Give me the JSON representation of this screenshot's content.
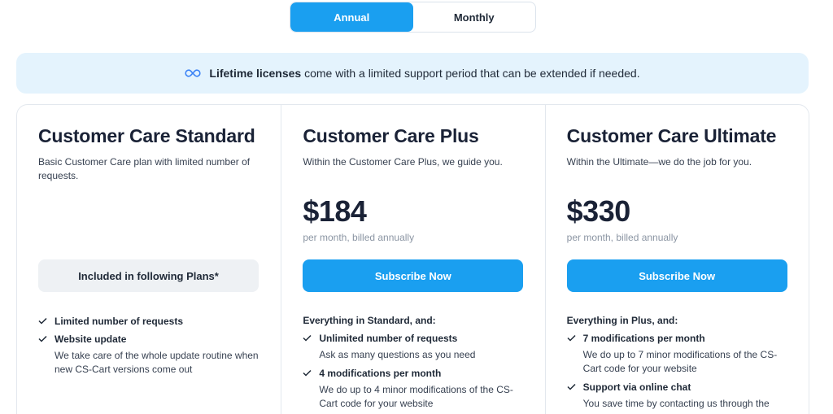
{
  "billing_toggle": {
    "annual": "Annual",
    "monthly": "Monthly"
  },
  "notice": {
    "bold": "Lifetime licenses",
    "rest": "come with a limited support period that can be extended if needed.",
    "icon": "infinity-icon"
  },
  "plans": [
    {
      "title": "Customer Care Standard",
      "desc": "Basic Customer Care plan with limited number of requests.",
      "cta": "Included in following Plans*",
      "features": [
        {
          "title": "Limited number of requests",
          "sub": ""
        },
        {
          "title": "Website update",
          "sub": "We take care of the whole update routine when new CS-Cart versions come out"
        }
      ]
    },
    {
      "title": "Customer Care Plus",
      "desc": "Within the Customer Care Plus, we guide you.",
      "price": "$184",
      "price_note": "per month, billed annually",
      "cta": "Subscribe Now",
      "features_head": "Everything in Standard, and:",
      "features": [
        {
          "title": "Unlimited number of requests",
          "sub": "Ask as many questions as you need"
        },
        {
          "title": "4 modifications per month",
          "sub": "We do up to 4 minor modifications of the CS-Cart code for your website"
        }
      ]
    },
    {
      "title": "Customer Care Ultimate",
      "desc": "Within the Ultimate—we do the job for you.",
      "price": "$330",
      "price_note": "per month, billed annually",
      "cta": "Subscribe Now",
      "features_head": "Everything in Plus, and:",
      "features": [
        {
          "title": "7 modifications per month",
          "sub": "We do up to 7 minor modifications of the CS-Cart code for your website"
        },
        {
          "title": "Support via online chat",
          "sub": "You save time by contacting us through the"
        }
      ]
    }
  ],
  "colors": {
    "accent": "#1a9ff0",
    "notice_bg": "#e4f3fd",
    "muted_button": "#eef1f4"
  }
}
